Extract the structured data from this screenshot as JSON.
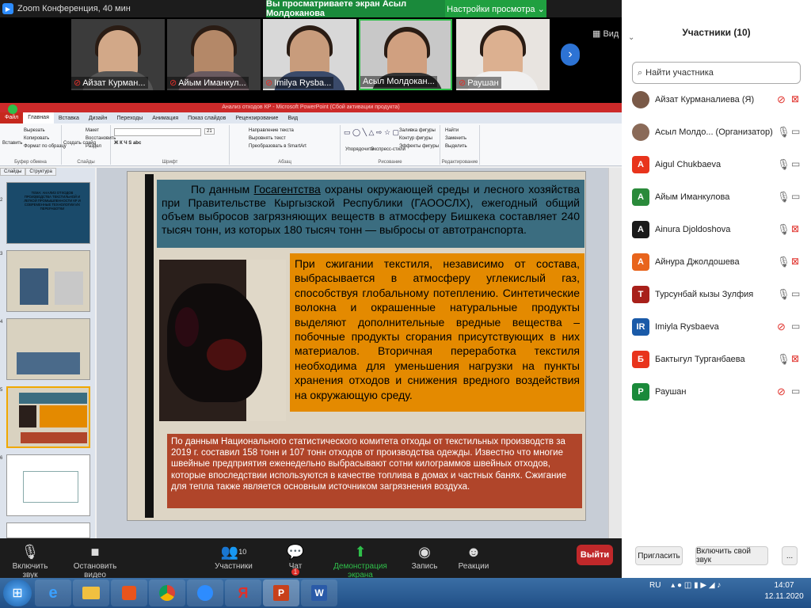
{
  "titlebar": {
    "title": "Zoom Конференция, 40 мин"
  },
  "share_banner": {
    "text": "Вы просматриваете экран Асыл Молдоканова",
    "view_options": "Настройки просмотра ⌄"
  },
  "video_strip": {
    "tiles": [
      {
        "name": "Айзат Курман..."
      },
      {
        "name": "Айым Иманкул..."
      },
      {
        "name": "Imilya Rysba..."
      },
      {
        "name": "Асыл Молдокан..."
      },
      {
        "name": "Раушан"
      }
    ],
    "view_label": "Вид"
  },
  "ppt": {
    "window_title": "Анализ отходов КР  -  Microsoft PowerPoint (Сбой активации продукта)",
    "tabs": [
      "Файл",
      "Главная",
      "Вставка",
      "Дизайн",
      "Переходы",
      "Анимация",
      "Показ слайдов",
      "Рецензирование",
      "Вид"
    ],
    "ribbon": {
      "clipboard": {
        "paste": "Вставить",
        "cut": "Вырезать",
        "copy": "Копировать",
        "format": "Формат по образцу",
        "label": "Буфер обмена"
      },
      "slides": {
        "create": "Создать слайд",
        "layout": "Макет",
        "reset": "Восстановить",
        "section": "Раздел",
        "label": "Слайды"
      },
      "font": {
        "size": "21",
        "label": "Шрифт"
      },
      "paragraph": {
        "dir": "Направление текста",
        "align": "Выровнять текст",
        "smartart": "Преобразовать в SmartArt",
        "label": "Абзац"
      },
      "drawing": {
        "arrange": "Упорядочить",
        "styles": "Экспресс-стили",
        "fill": "Заливка фигуры",
        "outline": "Контур фигуры",
        "effects": "Эффекты фигуры",
        "label": "Рисование"
      },
      "editing": {
        "find": "Найти",
        "replace": "Заменить",
        "select": "Выделить",
        "label": "Редактирование"
      }
    },
    "panel_tabs": [
      "Слайды",
      "Структура"
    ],
    "thumb_numbers": [
      "2",
      "3",
      "4",
      "5",
      "6"
    ],
    "thumb1_text": "ТЕМА: АНАЛИЗ ОТХОДОВ ПРОИЗВОДСТВА ТЕКСТИЛЬНОЙ И ЛЕГКОЙ ПРОМЫШЛЕННОСТИ КР И СОВРЕМЕННЫЕ ТЕХНОЛОГИИ ИХ ПЕРЕРАБОТКИ",
    "slide": {
      "box1_pre": "По данным ",
      "box1_link": "Госагентства",
      "box1_post": " охраны окружающей среды и лесного хозяйства при Правительстве Кыргызской Республики (ГАООСЛХ), ежегодный общий объем выбросов загрязняющих веществ в атмосферу Бишкека составляет 240 тысяч тонн, из которых 180 тысяч тонн — выбросы от автотранспорта.",
      "box2": "При сжигании текстиля, независимо от состава, выбрасывается в атмосферу углекислый газ, способствуя глобальному потеплению. Синтетические волокна и окрашенные натуральные продукты выделяют дополнительные вредные вещества – побочные продукты сгорания присутствующих в них материалов. Вторичная переработка текстиля необходима для уменьшения нагрузки на пункты хранения отходов и снижения вредного воздействия на окружающую среду.",
      "box3": "По данным Национального статистического  комитета отходы  от текстильных производств за 2019 г. составил 158 тонн и  107 тонн отходов  от производства одежды. Известно что многие швейные предприятия еженедельно выбрасывают сотни килограммов швейных отходов, которые впоследствии используются в качестве топлива в домах и частных банях. Сжигание для тепла также является основным источником загрязнения воздуха."
    }
  },
  "toolbar": {
    "mute": "Включить звук",
    "video": "Остановить видео",
    "participants": "Участники",
    "participants_count": "10",
    "chat": "Чат",
    "chat_badge": "1",
    "share": "Демонстрация экрана",
    "record": "Запись",
    "reactions": "Реакции",
    "end": "Выйти"
  },
  "participants_panel": {
    "title": "Участники (10)",
    "search_placeholder": "Найти участника",
    "items": [
      {
        "initial": "",
        "name": "Айзат Курманалиева (Я)",
        "color": "#7a5a48",
        "mic_muted": true,
        "cam_off": true
      },
      {
        "initial": "",
        "name": "Асыл Молдо...  (Организатор)",
        "color": "#8a6a58",
        "mic_muted": false,
        "cam_off": false
      },
      {
        "initial": "A",
        "name": "Aigul Chukbaeva",
        "color": "#e8341c",
        "mic_muted": false,
        "cam_off": false
      },
      {
        "initial": "А",
        "name": "Айым Иманкулова",
        "color": "#2a8a3a",
        "mic_muted": false,
        "cam_off": false
      },
      {
        "initial": "A",
        "name": "Ainura Djoldoshova",
        "color": "#1a1a1a",
        "mic_muted": false,
        "cam_off": true
      },
      {
        "initial": "А",
        "name": "Айнура Джолдошева",
        "color": "#e8641c",
        "mic_muted": false,
        "cam_off": true
      },
      {
        "initial": "Т",
        "name": "Турсунбай кызы Зулфия",
        "color": "#a8201a",
        "mic_muted": false,
        "cam_off": false
      },
      {
        "initial": "IR",
        "name": "Imiyla Rysbaeva",
        "color": "#1a5aa8",
        "mic_muted": true,
        "cam_off": false
      },
      {
        "initial": "Б",
        "name": "Бактыгул Турганбаева",
        "color": "#e8341c",
        "mic_muted": false,
        "cam_off": true
      },
      {
        "initial": "Р",
        "name": "Раушан",
        "color": "#1a8a3a",
        "mic_muted": true,
        "cam_off": false
      }
    ],
    "invite": "Пригласить",
    "unmute_self": "Включить свой звук",
    "more": "..."
  },
  "taskbar": {
    "lang": "RU",
    "time": "14:07",
    "date": "12.11.2020"
  }
}
